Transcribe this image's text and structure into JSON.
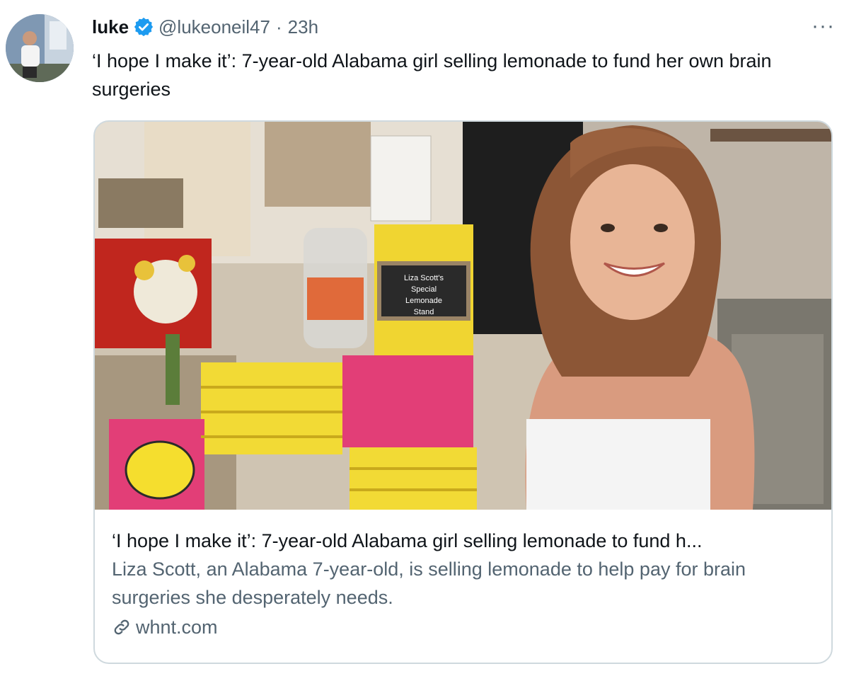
{
  "tweet": {
    "author_name": "luke",
    "handle": "@lukeoneil47",
    "separator": "·",
    "timestamp": "23h",
    "more_label": "···",
    "text": "‘I hope I make it’: 7-year-old Alabama girl selling lemonade to fund her own brain surgeries",
    "avatar_icon": "user-avatar",
    "verified_icon": "verified-badge-icon"
  },
  "card": {
    "title": "‘I hope I make it’: 7-year-old Alabama girl selling lemonade to fund h...",
    "description": "Liza Scott, an Alabama 7-year-old, is selling lemonade to help pay for brain surgeries she desperately needs.",
    "domain": "whnt.com",
    "link_icon": "link-icon",
    "sign_text": [
      "Liza Scott's",
      "Special",
      "Lemonade",
      "Stand"
    ]
  },
  "colors": {
    "verified_blue": "#1d9bf0",
    "secondary_text": "#536471",
    "primary_text": "#0f1419",
    "card_border": "#cfd9de"
  }
}
